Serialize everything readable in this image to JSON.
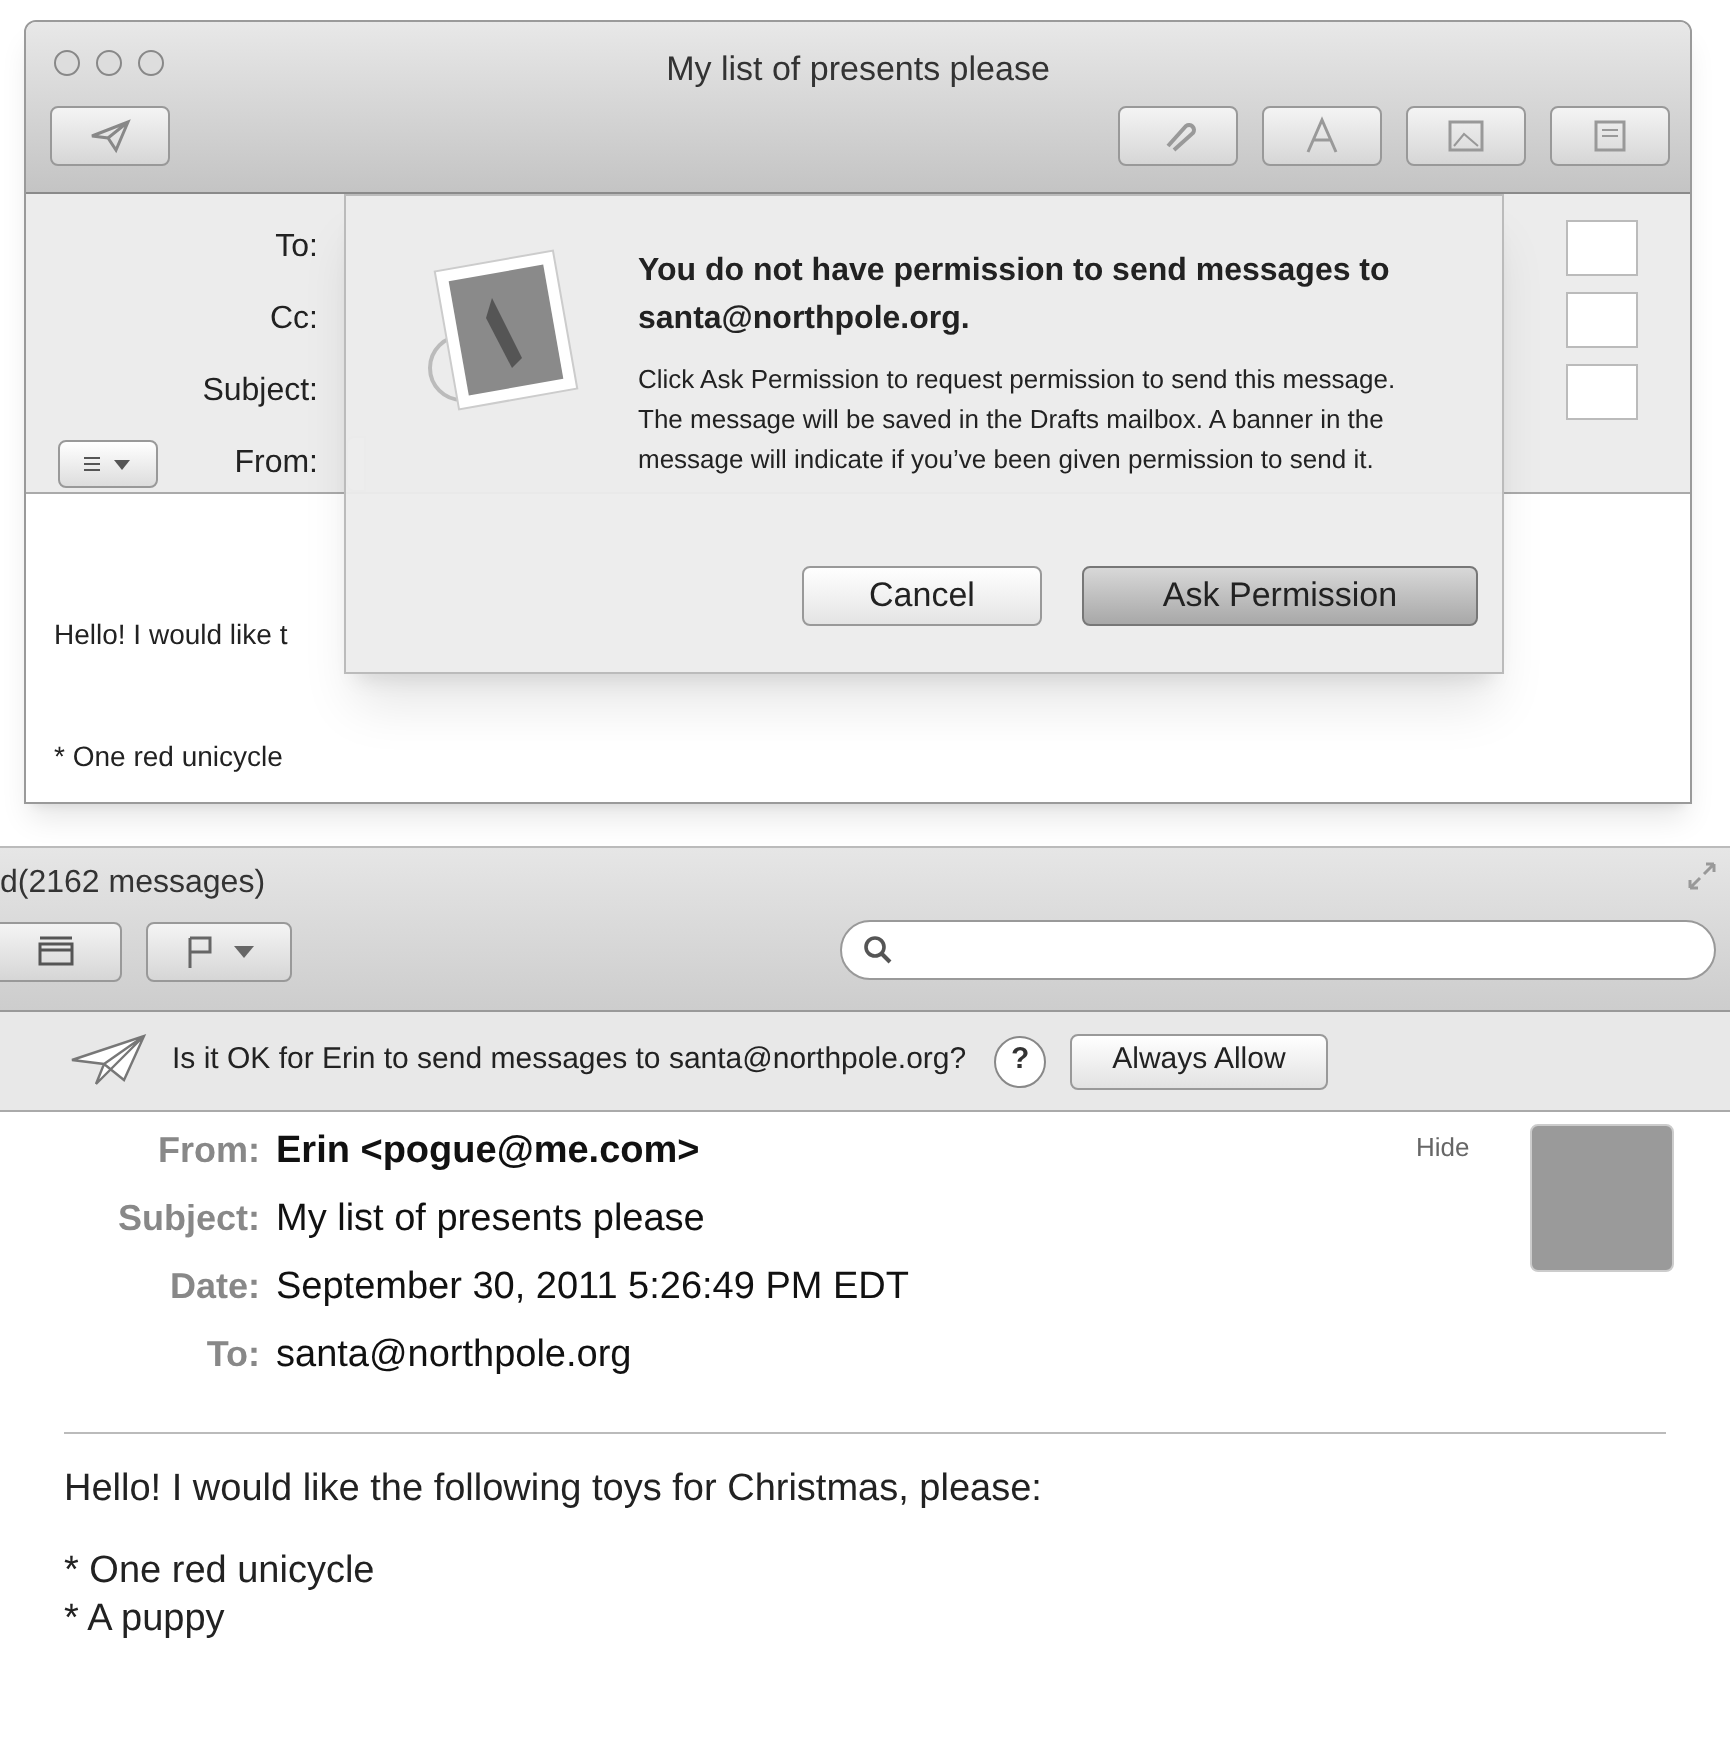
{
  "compose": {
    "title": "My list of presents please",
    "fields": [
      {
        "label": "To:",
        "kind": "address"
      },
      {
        "label": "Cc:",
        "kind": "address"
      },
      {
        "label": "Subject:",
        "kind": "address"
      },
      {
        "label": "From:",
        "kind": "popup"
      }
    ],
    "body": [
      "Hello! I would like t",
      "* One red unicycle"
    ]
  },
  "sheet": {
    "title": "You do not have permission to send messages to santa@northpole.org.",
    "message": "Click Ask Permission to request permission to send this message. The message will be saved in the Drafts mailbox. A banner in the message will indicate if you’ve been given permission to send it.",
    "buttons": [
      {
        "label": "Cancel",
        "default": false
      },
      {
        "label": "Ask Permission",
        "default": true
      }
    ]
  },
  "viewer": {
    "title": "d(2162 messages)",
    "banner": {
      "text": "Is it OK for Erin to send messages to santa@northpole.org?",
      "help": "?",
      "button": "Always Allow"
    },
    "hide": "Hide",
    "header": [
      {
        "label": "From:",
        "value": "Erin <pogue@me.com>",
        "bold": true
      },
      {
        "label": "Subject:",
        "value": "My list of presents please",
        "bold": false
      },
      {
        "label": "Date:",
        "value": "September 30, 2011 5:26:49 PM EDT",
        "bold": false
      },
      {
        "label": "To:",
        "value": "santa@northpole.org",
        "bold": false
      }
    ],
    "body": [
      "Hello! I would like the following toys for Christmas, please:",
      "* One red unicycle",
      "* A puppy"
    ]
  }
}
